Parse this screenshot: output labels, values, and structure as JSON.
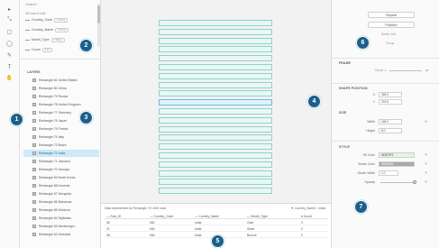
{
  "toolbar": {
    "tools": [
      {
        "name": "select-tool-icon",
        "glyph": "▸"
      },
      {
        "name": "direct-select-icon",
        "glyph": "⤡"
      },
      {
        "name": "rectangle-tool-icon",
        "glyph": "▢"
      },
      {
        "name": "ellipse-tool-icon",
        "glyph": "◯"
      },
      {
        "name": "pen-tool-icon",
        "glyph": "✎"
      },
      {
        "name": "text-tool-icon",
        "glyph": "T"
      },
      {
        "name": "hand-tool-icon",
        "glyph": "✋"
      }
    ]
  },
  "left_panel": {
    "top_note": "Columns",
    "count_text": "4/5 rows in total",
    "columns": [
      {
        "name": "Country_Code",
        "chip": "# String"
      },
      {
        "name": "Country_Name",
        "chip": "# String"
      },
      {
        "name": "Model_Type",
        "chip": "# String"
      },
      {
        "name": "Count",
        "chip": "# Int"
      }
    ],
    "layers_title": "LAYERS",
    "layers": [
      "Rectangle 81 United States",
      "Rectangle 80 China",
      "Rectangle 79 Russia",
      "Rectangle 78 United Kingdom",
      "Rectangle 77 Germany",
      "Rectangle 76 Japan",
      "Rectangle 75 France",
      "Rectangle 74 Italy",
      "Rectangle 73 Brazil",
      "Rectangle 72 India",
      "Rectangle 71 Jamaica",
      "Rectangle 70 Georgia",
      "Rectangle 69 North Korea",
      "Rectangle 68 Armenia",
      "Rectangle 67 Mongolia",
      "Rectangle 66 Bahamas",
      "Rectangle 65 Moldova",
      "Rectangle 64 Tajikistan",
      "Rectangle 63 Montenegro",
      "Rectangle 62 Grenada"
    ],
    "selected_index": 9
  },
  "data_table": {
    "caption": "Data represented by Rectangle 72: 3/40 rows",
    "filter": "Country_Name = India",
    "columns": [
      "Row_ID",
      "Country_Code",
      "Country_Name",
      "Model_Type",
      "Count"
    ],
    "rows": [
      [
        "36",
        "IND",
        "India",
        "Gold",
        "0"
      ],
      [
        "37",
        "IND",
        "India",
        "Silver",
        "0"
      ],
      [
        "38",
        "IND",
        "India",
        "Bronze",
        "0"
      ]
    ]
  },
  "inspector": {
    "buttons": {
      "repeat": "Repeat",
      "partition": "Partition",
      "break_link": "Break Link",
      "group": "Group"
    },
    "frame": {
      "title": "FRAME",
      "count_label": "Count: 1",
      "unit": "px"
    },
    "shape_position": {
      "title": "SHAPE POSITION",
      "x_label": "X",
      "x_value": "365.5",
      "y_label": "Y",
      "y_value": "219.6"
    },
    "size": {
      "title": "SIZE",
      "width_label": "Width",
      "width_value": "168.0",
      "height_label": "Height",
      "height_value": "8.0"
    },
    "style": {
      "title": "STYLE",
      "fill_label": "Fill Color",
      "fill_value": "#E8F9F9",
      "stroke_label": "Stroke Color",
      "stroke_value": "#B2B2B2",
      "stroke_width_label": "Stroke Width",
      "stroke_width_value": "1.0",
      "opacity_label": "Opacity",
      "opacity_value": 1.0
    }
  },
  "callouts": [
    "1",
    "2",
    "3",
    "4",
    "5",
    "6",
    "7"
  ],
  "colors": {
    "selection": "#cfe9f7",
    "rect_fill": "#e8f7f5",
    "rect_stroke": "#8fd3c9",
    "badge": "#1c5f8a"
  }
}
